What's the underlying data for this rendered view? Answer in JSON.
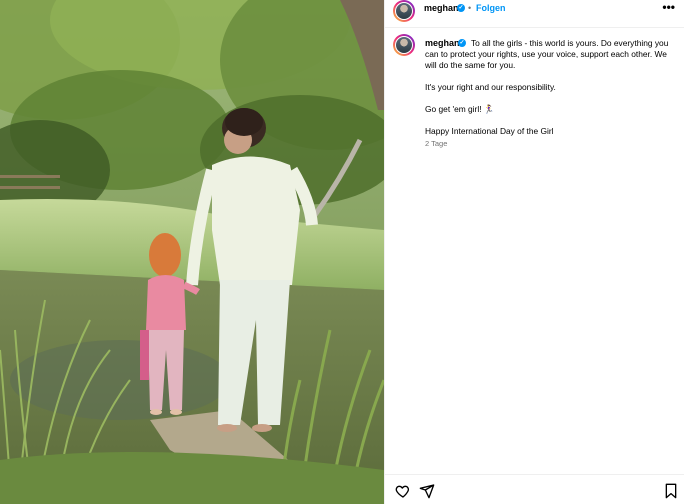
{
  "post": {
    "username": "meghan",
    "verified": true,
    "separator": "•",
    "follow_label": "Folgen",
    "more_label": "•••",
    "caption": {
      "username": "meghan",
      "line1": "To all the girls - this world is yours. Do everything you can to protect your rights, use your voice, support each other. We will do the same for you.",
      "line2": "It's your right and our responsibility.",
      "line3": "Go get 'em girl! 🏃‍♀️",
      "line4": "Happy International Day of the Girl"
    },
    "timestamp": "2 Tage"
  },
  "icons": {
    "verified": "verified-badge-icon",
    "like": "heart-icon",
    "share": "paper-plane-icon",
    "save": "bookmark-icon",
    "more": "more-options-icon"
  },
  "colors": {
    "accent": "#0095f6",
    "secondary_text": "#737373",
    "border": "#efefef"
  }
}
